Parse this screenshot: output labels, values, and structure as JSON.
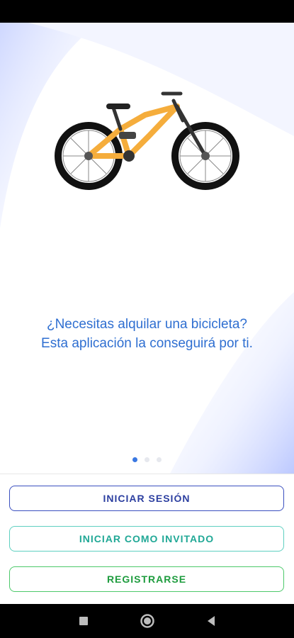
{
  "onboarding": {
    "tagline_line1": "¿Necesitas alquilar una bicicleta?",
    "tagline_line2": "Esta aplicación la conseguirá por ti.",
    "illustration_icon": "mountain-bike-icon",
    "page_indicator": {
      "count": 3,
      "active": 1
    }
  },
  "actions": {
    "login_label": "INICIAR SESIÓN",
    "guest_label": "INICIAR COMO INVITADO",
    "register_label": "REGISTRARSE"
  },
  "system_nav": {
    "recents_icon": "square-icon",
    "home_icon": "circle-icon",
    "back_icon": "triangle-back-icon"
  },
  "colors": {
    "tagline": "#2f6fd1",
    "login_border": "#3a4fbf",
    "guest_border": "#5ed0c0",
    "register_border": "#4cc96a",
    "bike_frame": "#f5ad3c"
  }
}
